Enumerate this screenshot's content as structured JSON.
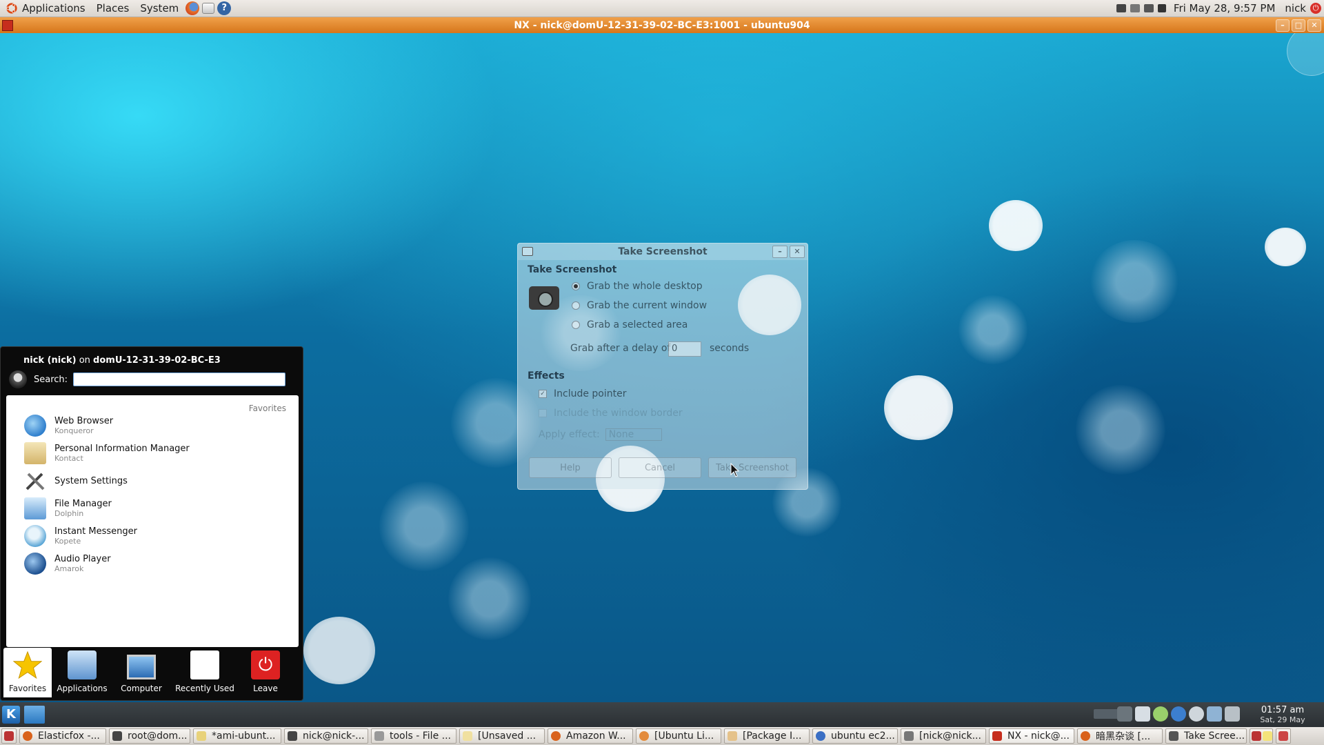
{
  "gnome_panel": {
    "menus": [
      "Applications",
      "Places",
      "System"
    ],
    "clock": "Fri May 28,  9:57 PM",
    "user": "nick"
  },
  "nx_window": {
    "title": "NX - nick@domU-12-31-39-02-BC-E3:1001 - ubuntu904"
  },
  "screenshot_dialog": {
    "window_title": "Take Screenshot",
    "section_title": "Take Screenshot",
    "options": [
      "Grab the whole desktop",
      "Grab the current window",
      "Grab a selected area"
    ],
    "selected_option": "Grab the whole desktop",
    "delay_label": "Grab after a delay of",
    "delay_value": "0",
    "delay_unit": "seconds",
    "effects_title": "Effects",
    "include_pointer": "Include pointer",
    "include_border": "Include the window border",
    "apply_effect_label": "Apply effect:",
    "apply_effect_value": "None",
    "buttons": {
      "help": "Help",
      "cancel": "Cancel",
      "take": "Take Screenshot"
    }
  },
  "kickoff": {
    "user": "nick (nick)",
    "on": "on",
    "host": "domU-12-31-39-02-BC-E3",
    "search_label": "Search:",
    "list_title": "Favorites",
    "items": [
      {
        "name": "Web Browser",
        "sub": "Konqueror",
        "icon": "globe-icon"
      },
      {
        "name": "Personal Information Manager",
        "sub": "Kontact",
        "icon": "kontact-icon"
      },
      {
        "name": "System Settings",
        "sub": "",
        "icon": "tools-icon"
      },
      {
        "name": "File Manager",
        "sub": "Dolphin",
        "icon": "file-manager-icon"
      },
      {
        "name": "Instant Messenger",
        "sub": "Kopete",
        "icon": "messenger-icon"
      },
      {
        "name": "Audio Player",
        "sub": "Amarok",
        "icon": "amarok-icon"
      }
    ],
    "tabs": [
      "Favorites",
      "Applications",
      "Computer",
      "Recently Used",
      "Leave"
    ]
  },
  "kde_panel": {
    "time": "01:57 am",
    "date": "Sat, 29 May",
    "tasks": [
      "Elasticfox -...",
      "root@dom...",
      "*ami-ubunt...",
      "nick@nick-...",
      "tools - File ...",
      "[Unsaved ...",
      "Amazon W...",
      "[Ubuntu Li...",
      "[Package I...",
      "ubuntu ec2...",
      "[nick@nick...",
      "NX - nick@...",
      "暗黑杂谈 [...",
      "Take Scree..."
    ]
  },
  "colors": {
    "nx_titlebar": "#e2861f",
    "kickoff_bg": "#0b0b0b",
    "kde_panel": "#2a2f33"
  }
}
